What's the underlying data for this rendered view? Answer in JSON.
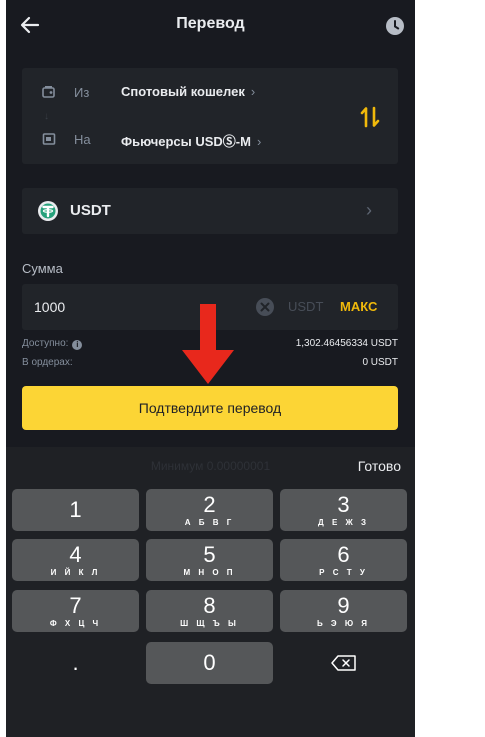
{
  "header": {
    "title": "Перевод",
    "back_icon": "arrow-left-icon",
    "history_icon": "clock-icon"
  },
  "transfer": {
    "from_label": "Из",
    "from_value": "Спотовый кошелек",
    "to_label": "На",
    "to_value": "Фьючерсы USDⓈ-M",
    "chevron": "›",
    "swap_icon": "swap-vertical-icon"
  },
  "coin": {
    "name": "USDT",
    "chevron": "›"
  },
  "amount": {
    "label": "Сумма",
    "value": "1000",
    "unit": "USDT",
    "max_label": "МАКС"
  },
  "info": {
    "available_label": "Доступно:",
    "available_value": "1,302.46456334 USDT",
    "in_orders_label": "В ордерах:",
    "in_orders_value": "0 USDT"
  },
  "confirm_label": "Подтвердите перевод",
  "keyboard": {
    "hint": "Минимум 0.00000001",
    "done_label": "Готово",
    "keys": [
      {
        "digit": "1",
        "letters": ""
      },
      {
        "digit": "2",
        "letters": "А Б В Г"
      },
      {
        "digit": "3",
        "letters": "Д Е Ж З"
      },
      {
        "digit": "4",
        "letters": "И Й К Л"
      },
      {
        "digit": "5",
        "letters": "М Н О П"
      },
      {
        "digit": "6",
        "letters": "Р С Т У"
      },
      {
        "digit": "7",
        "letters": "Ф Х Ц Ч"
      },
      {
        "digit": "8",
        "letters": "Ш Щ Ъ Ы"
      },
      {
        "digit": "9",
        "letters": "Ь Э Ю Я"
      },
      {
        "digit": ".",
        "letters": ""
      },
      {
        "digit": "0",
        "letters": ""
      }
    ]
  },
  "colors": {
    "accent": "#f0b90b",
    "button": "#fcd535",
    "background": "#181a20",
    "card": "#212429",
    "annotation_arrow": "#e8281c"
  }
}
